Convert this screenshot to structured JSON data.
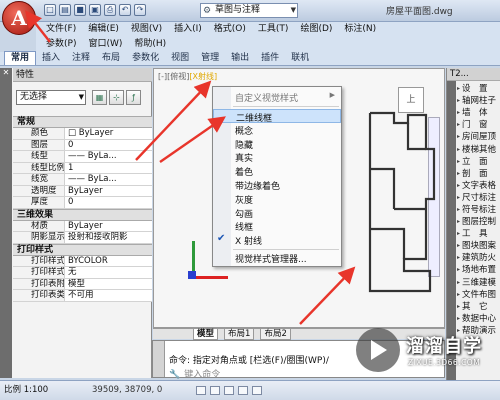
{
  "title_bar": {
    "app_glyph": "A",
    "workspace": "草图与注释",
    "document": "房屋平面图.dwg"
  },
  "menu_bar": {
    "row1": [
      "文件(F)",
      "编辑(E)",
      "视图(V)",
      "插入(I)",
      "格式(O)",
      "工具(T)",
      "绘图(D)",
      "标注(N)"
    ],
    "row2": [
      "参数(P)",
      "窗口(W)",
      "帮助(H)"
    ]
  },
  "ribbon_tabs": [
    "常用",
    "插入",
    "注释",
    "布局",
    "参数化",
    "视图",
    "管理",
    "输出",
    "插件",
    "联机"
  ],
  "properties": {
    "title": "特性",
    "selection": "无选择",
    "sections": [
      {
        "title": "常规",
        "rows": [
          {
            "key": "颜色",
            "value": "□ ByLayer"
          },
          {
            "key": "图层",
            "value": "0"
          },
          {
            "key": "线型",
            "value": "—— ByLa..."
          },
          {
            "key": "线型比例",
            "value": "1"
          },
          {
            "key": "线宽",
            "value": "—— ByLa..."
          },
          {
            "key": "透明度",
            "value": "ByLayer"
          },
          {
            "key": "厚度",
            "value": "0"
          }
        ]
      },
      {
        "title": "三维效果",
        "rows": [
          {
            "key": "材质",
            "value": "ByLayer"
          },
          {
            "key": "阴影显示",
            "value": "投射和接收阴影"
          }
        ]
      },
      {
        "title": "打印样式",
        "rows": [
          {
            "key": "打印样式",
            "value": "BYCOLOR"
          },
          {
            "key": "打印样式表",
            "value": "无"
          },
          {
            "key": "打印表附...",
            "value": "模型"
          },
          {
            "key": "打印表类型",
            "value": "不可用"
          }
        ]
      }
    ]
  },
  "viewport": {
    "label_prefix": "[-][俯视]",
    "label_highlight": "[X射线]",
    "nav_label": "上"
  },
  "visual_style_menu": {
    "header": "自定义视觉样式",
    "items": [
      "二维线框",
      "概念",
      "隐藏",
      "真实",
      "着色",
      "带边缘着色",
      "灰度",
      "勾画",
      "线框",
      "X 射线"
    ],
    "checked_item": "X 射线",
    "hovered_item": "二维线框",
    "manager": "视觉样式管理器..."
  },
  "layout_tabs": [
    "模型",
    "布局1",
    "布局2"
  ],
  "command": {
    "history": "命令: 指定对角点或 [栏选(F)/圈围(WP)/",
    "prompt_placeholder": "键入命令"
  },
  "right_palette": {
    "title": "T2...",
    "items": [
      "设　置",
      "轴网柱子",
      "墙　体",
      "门　窗",
      "房间屋顶",
      "楼梯其他",
      "立　面",
      "剖　面",
      "文字表格",
      "尺寸标注",
      "符号标注",
      "图层控制",
      "工　具",
      "图块图案",
      "建筑防火",
      "场地布置",
      "三维建模",
      "文件布图",
      "其　它",
      "数据中心",
      "帮助演示"
    ]
  },
  "status_bar": {
    "scale": "比例 1:100",
    "coords": "39509, 38709, 0"
  },
  "watermark": {
    "brand": "溜溜自学",
    "url": "ZIXUE.3D66.COM"
  },
  "colors": {
    "annotation_arrow": "#e8352b",
    "menu_hover": "#cde3fb"
  }
}
